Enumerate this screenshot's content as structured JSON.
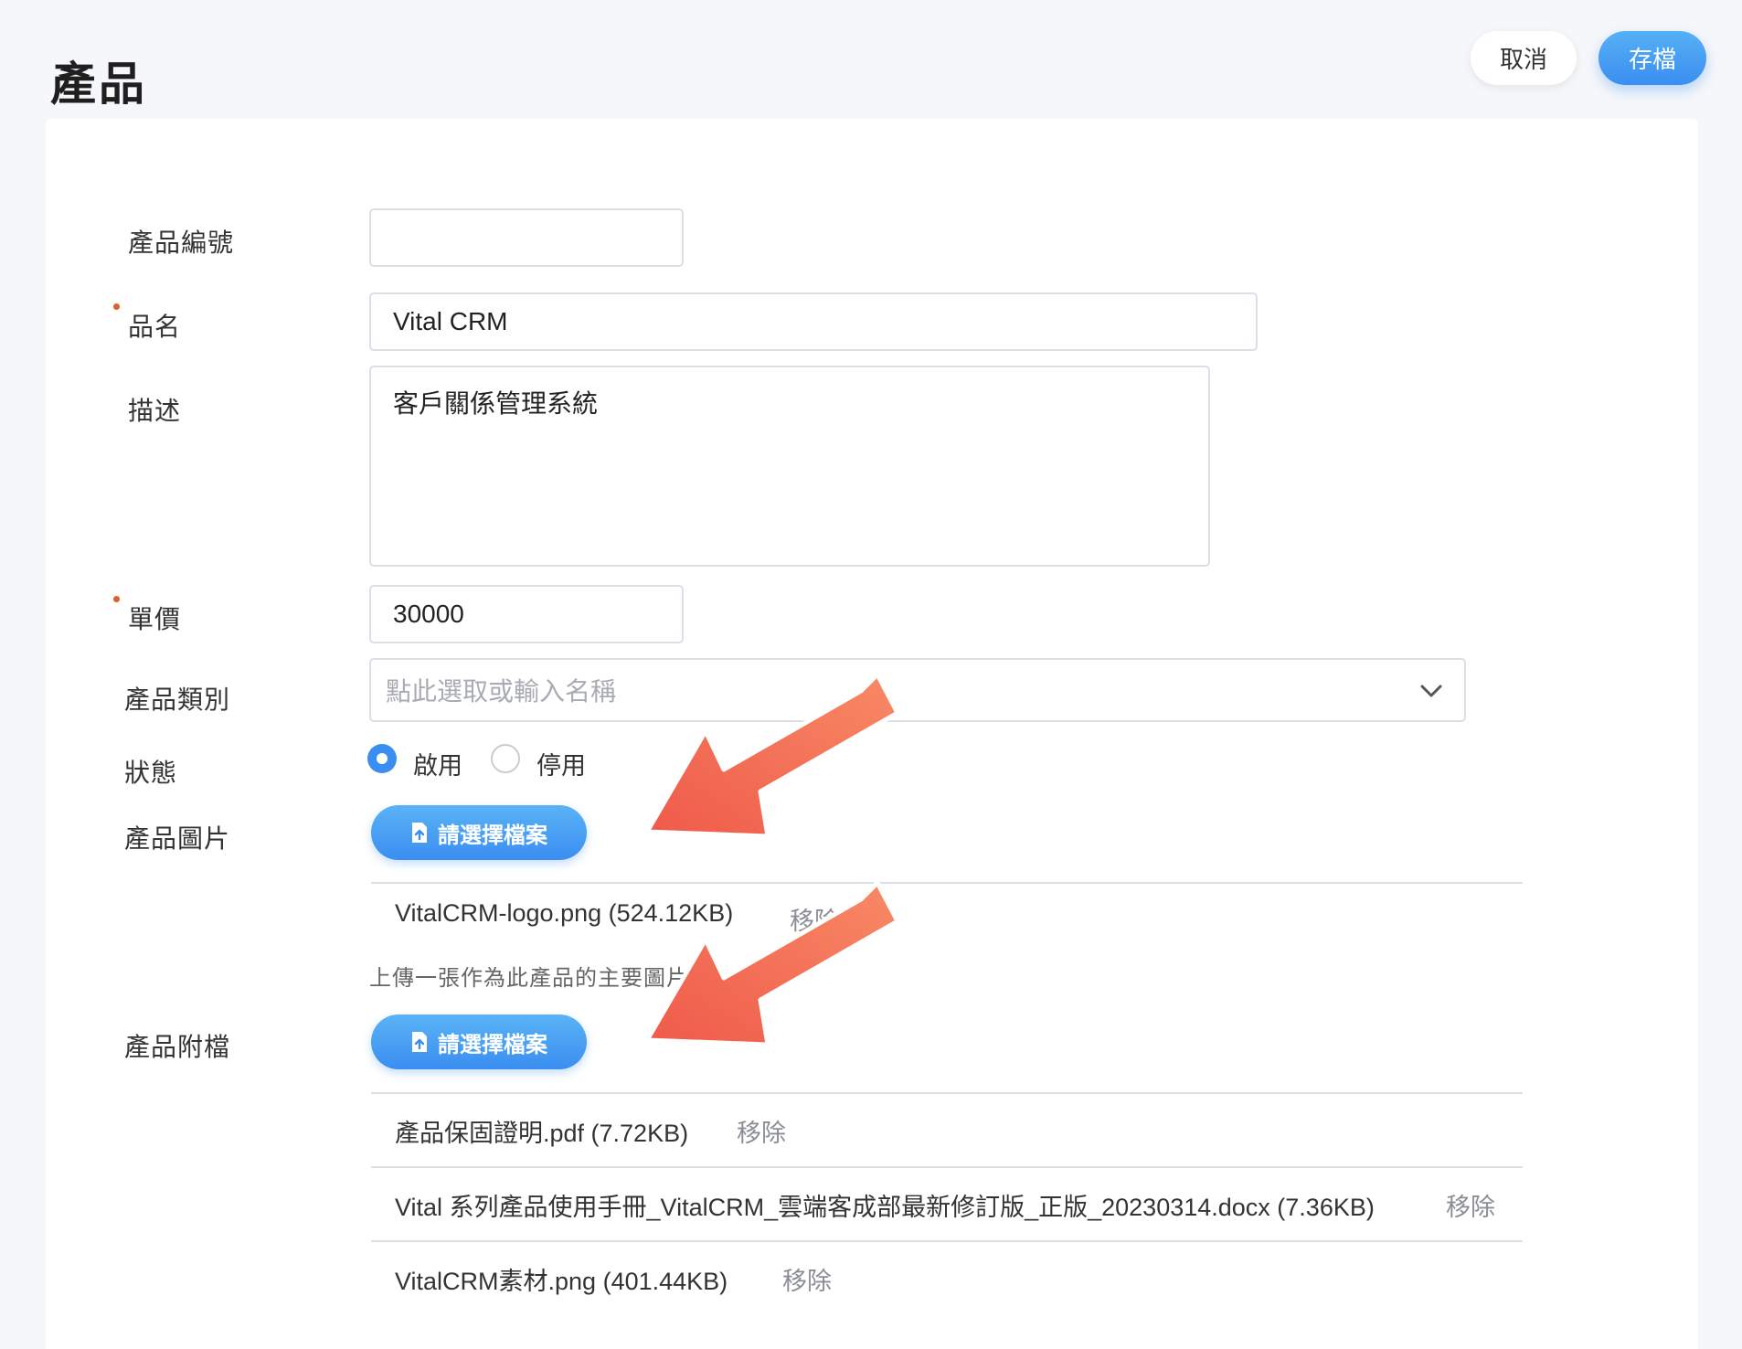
{
  "header": {
    "title": "產品",
    "cancel_label": "取消",
    "save_label": "存檔"
  },
  "form": {
    "product_code": {
      "label": "產品編號",
      "value": ""
    },
    "product_name": {
      "label": "品名",
      "value": "Vital CRM",
      "required": true
    },
    "description": {
      "label": "描述",
      "value": "客戶關係管理系統"
    },
    "unit_price": {
      "label": "單價",
      "value": "30000",
      "required": true
    },
    "category": {
      "label": "產品類別",
      "placeholder": "點此選取或輸入名稱"
    },
    "status": {
      "label": "狀態",
      "options": [
        {
          "label": "啟用",
          "selected": true
        },
        {
          "label": "停用",
          "selected": false
        }
      ]
    },
    "product_image": {
      "label": "產品圖片",
      "button_label": "請選擇檔案",
      "files": [
        {
          "name": "VitalCRM-logo.png (524.12KB)",
          "remove": "移除"
        }
      ],
      "hint": "上傳一張作為此產品的主要圖片"
    },
    "attachments": {
      "label": "產品附檔",
      "button_label": "請選擇檔案",
      "files": [
        {
          "name": "產品保固證明.pdf (7.72KB)",
          "remove": "移除"
        },
        {
          "name": "Vital 系列產品使用手冊_VitalCRM_雲端客成部最新修訂版_正版_20230314.docx (7.36KB)",
          "remove": "移除"
        },
        {
          "name": "VitalCRM素材.png (401.44KB)",
          "remove": "移除"
        }
      ]
    }
  },
  "colors": {
    "accent": "#3a8ef0",
    "required": "#e0602a",
    "annotation_arrow": "#f26a52"
  },
  "icons": {
    "select_chevron": "chevron-down-icon",
    "upload": "file-upload-icon",
    "annotation": "annotation-arrow-icon"
  }
}
